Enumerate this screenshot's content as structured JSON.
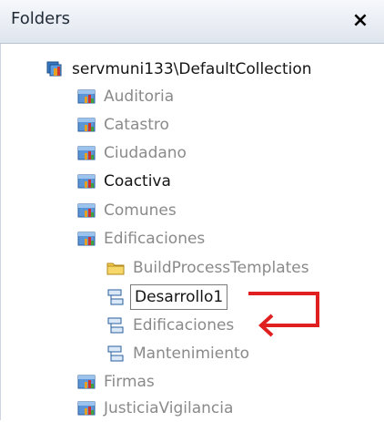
{
  "panel": {
    "title": "Folders",
    "close_glyph": "×"
  },
  "tree": {
    "root": {
      "label": "servmuni133\\DefaultCollection",
      "icon": "collection-icon"
    },
    "projects": [
      {
        "label": "Auditoria",
        "icon": "team-project-icon"
      },
      {
        "label": "Catastro",
        "icon": "team-project-icon"
      },
      {
        "label": "Ciudadano",
        "icon": "team-project-icon"
      },
      {
        "label": "Coactiva",
        "icon": "team-project-icon"
      },
      {
        "label": "Comunes",
        "icon": "team-project-icon"
      },
      {
        "label": "Edificaciones",
        "icon": "team-project-icon"
      },
      {
        "label": "Firmas",
        "icon": "team-project-icon"
      },
      {
        "label": "JusticiaVigilancia",
        "icon": "team-project-icon"
      }
    ],
    "edificaciones_children": [
      {
        "label": "BuildProcessTemplates",
        "icon": "folder-icon"
      },
      {
        "label": "Desarrollo1",
        "icon": "branch-icon",
        "selected": true
      },
      {
        "label": "Edificaciones",
        "icon": "branch-icon"
      },
      {
        "label": "Mantenimiento",
        "icon": "branch-icon"
      }
    ]
  },
  "annotation": {
    "arrow_color": "#e02020"
  },
  "colors": {
    "grey_text": "#8a8a8a",
    "dark_text": "#141414"
  }
}
